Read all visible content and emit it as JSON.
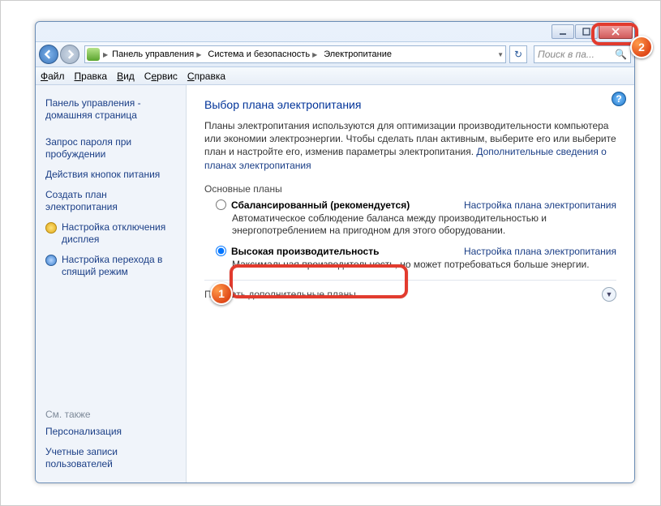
{
  "titlebar": {
    "min": "_",
    "max": "❐",
    "close": "✕"
  },
  "breadcrumbs": {
    "root": "Панель управления",
    "section": "Система и безопасность",
    "page": "Электропитание"
  },
  "search": {
    "placeholder": "Поиск в па...",
    "icon": "🔍"
  },
  "refresh": "↻",
  "menubar": {
    "file": "Файл",
    "edit": "Правка",
    "view": "Вид",
    "tools": "Сервис",
    "help": "Справка"
  },
  "sidebar": {
    "home": "Панель управления - домашняя страница",
    "links": [
      "Запрос пароля при пробуждении",
      "Действия кнопок питания",
      "Создать план электропитания",
      "Настройка отключения дисплея",
      "Настройка перехода в спящий режим"
    ],
    "see_also_label": "См. также",
    "see_also": [
      "Персонализация",
      "Учетные записи пользователей"
    ]
  },
  "main": {
    "title": "Выбор плана электропитания",
    "desc": "Планы электропитания используются для оптимизации производительности компьютера или экономии электроэнергии. Чтобы сделать план активным, выберите его или выберите план и настройте его, изменив параметры электропитания. ",
    "desc_link": "Дополнительные сведения о планах электропитания",
    "group": "Основные планы",
    "plans": [
      {
        "name": "Сбалансированный (рекомендуется)",
        "desc": "Автоматическое соблюдение баланса между производительностью и энергопотреблением на пригодном для этого оборудовании.",
        "cfg": "Настройка плана электропитания",
        "selected": false
      },
      {
        "name": "Высокая производительность",
        "desc": "Максимальная производительность, но может потребоваться больше энергии.",
        "cfg": "Настройка плана электропитания",
        "selected": true
      }
    ],
    "expand": "Показать дополнительные планы"
  },
  "callouts": {
    "n1": "1",
    "n2": "2"
  }
}
